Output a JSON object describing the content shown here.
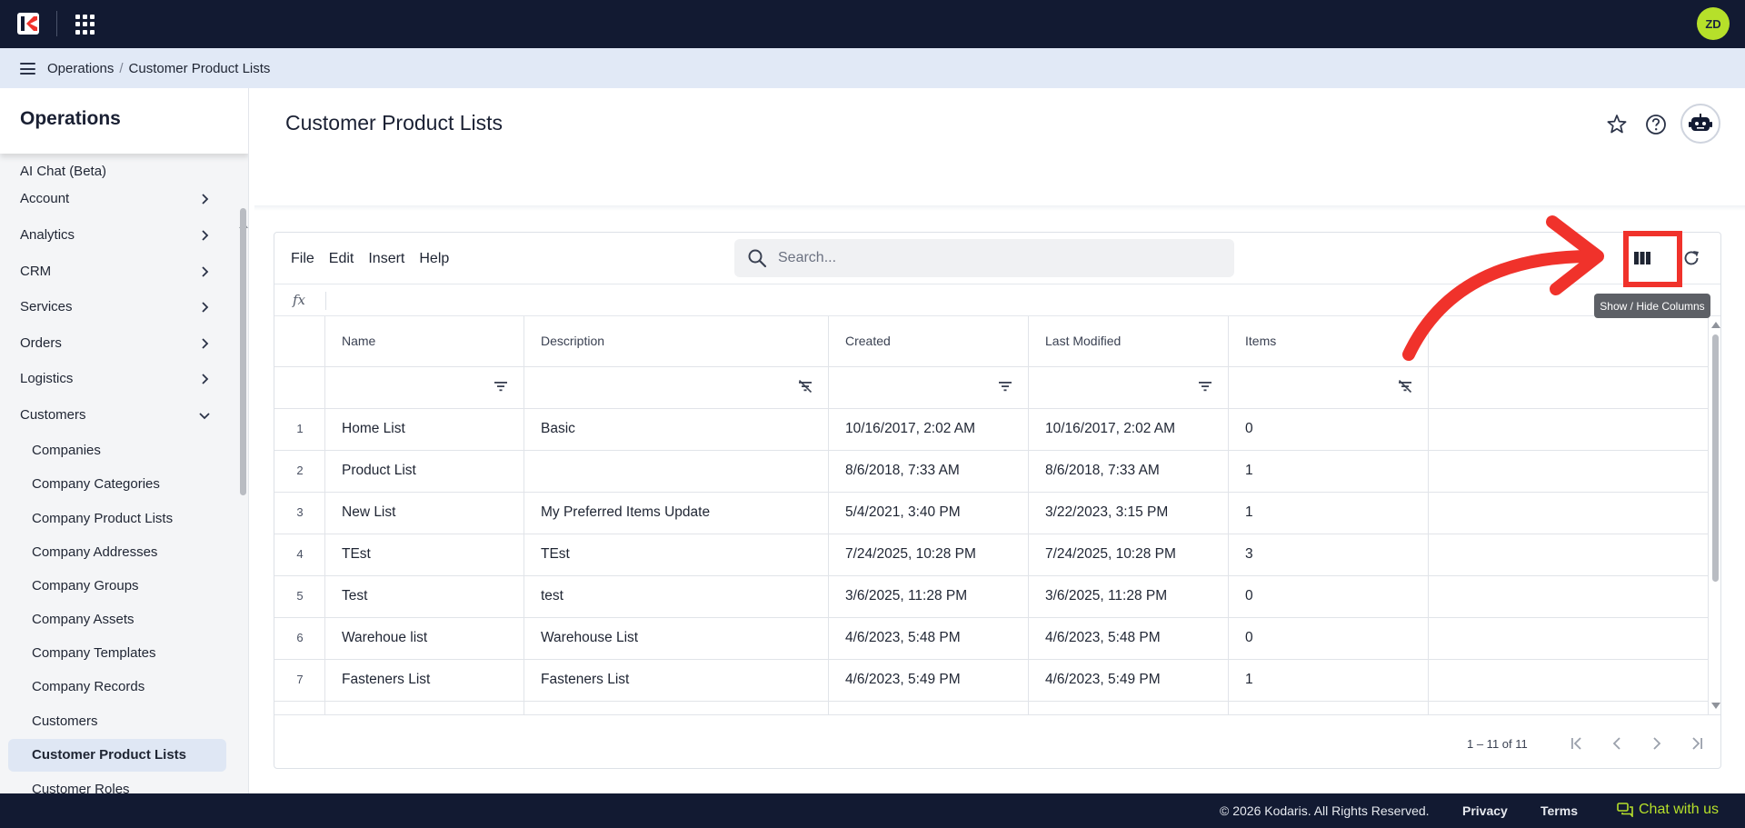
{
  "app": {
    "user_initials": "ZD"
  },
  "breadcrumb": {
    "items": [
      "Operations",
      "Customer Product Lists"
    ]
  },
  "sidebar": {
    "title": "Operations",
    "items": [
      {
        "label": "AI Chat (Beta)",
        "expandable": false
      },
      {
        "label": "Account",
        "expandable": true
      },
      {
        "label": "Analytics",
        "expandable": true
      },
      {
        "label": "CRM",
        "expandable": true
      },
      {
        "label": "Services",
        "expandable": true
      },
      {
        "label": "Orders",
        "expandable": true
      },
      {
        "label": "Logistics",
        "expandable": true
      },
      {
        "label": "Customers",
        "expandable": true,
        "expanded": true
      }
    ],
    "sub_items": [
      "Companies",
      "Company Categories",
      "Company Product Lists",
      "Company Addresses",
      "Company Groups",
      "Company Assets",
      "Company Templates",
      "Company Records",
      "Customers",
      "Customer Product Lists",
      "Customer Roles"
    ],
    "active_sub_item": "Customer Product Lists"
  },
  "page": {
    "title": "Customer Product Lists"
  },
  "toolbar": {
    "menus": [
      "File",
      "Edit",
      "Insert",
      "Help"
    ],
    "search_placeholder": "Search...",
    "formula_label": "fx"
  },
  "grid": {
    "columns": [
      "Name",
      "Description",
      "Created",
      "Last Modified",
      "Items"
    ],
    "filter_state": [
      "filter",
      "filter-off",
      "filter",
      "filter",
      "filter-off"
    ],
    "rows": [
      {
        "n": "1",
        "name": "Home List",
        "description": "Basic",
        "created": "10/16/2017, 2:02 AM",
        "modified": "10/16/2017, 2:02 AM",
        "items": "0"
      },
      {
        "n": "2",
        "name": "Product List",
        "description": "",
        "created": "8/6/2018, 7:33 AM",
        "modified": "8/6/2018, 7:33 AM",
        "items": "1"
      },
      {
        "n": "3",
        "name": "New List",
        "description": "My Preferred Items Update",
        "created": "5/4/2021, 3:40 PM",
        "modified": "3/22/2023, 3:15 PM",
        "items": "1"
      },
      {
        "n": "4",
        "name": "TEst",
        "description": "TEst",
        "created": "7/24/2025, 10:28 PM",
        "modified": "7/24/2025, 10:28 PM",
        "items": "3"
      },
      {
        "n": "5",
        "name": "Test",
        "description": "test",
        "created": "3/6/2025, 11:28 PM",
        "modified": "3/6/2025, 11:28 PM",
        "items": "0"
      },
      {
        "n": "6",
        "name": "Warehoue list",
        "description": "Warehouse List",
        "created": "4/6/2023, 5:48 PM",
        "modified": "4/6/2023, 5:48 PM",
        "items": "0"
      },
      {
        "n": "7",
        "name": "Fasteners List",
        "description": "Fasteners List",
        "created": "4/6/2023, 5:49 PM",
        "modified": "4/6/2023, 5:49 PM",
        "items": "1"
      }
    ],
    "pager_range": "1 – 11 of 11"
  },
  "tooltip": {
    "text": "Show / Hide Columns"
  },
  "footer": {
    "copyright": "© 2026 Kodaris. All Rights Reserved.",
    "privacy": "Privacy",
    "terms": "Terms",
    "chat": "Chat with us"
  },
  "colors": {
    "topbar": "#121a32",
    "accent": "#b6e02a",
    "annotation": "#f0322b"
  }
}
